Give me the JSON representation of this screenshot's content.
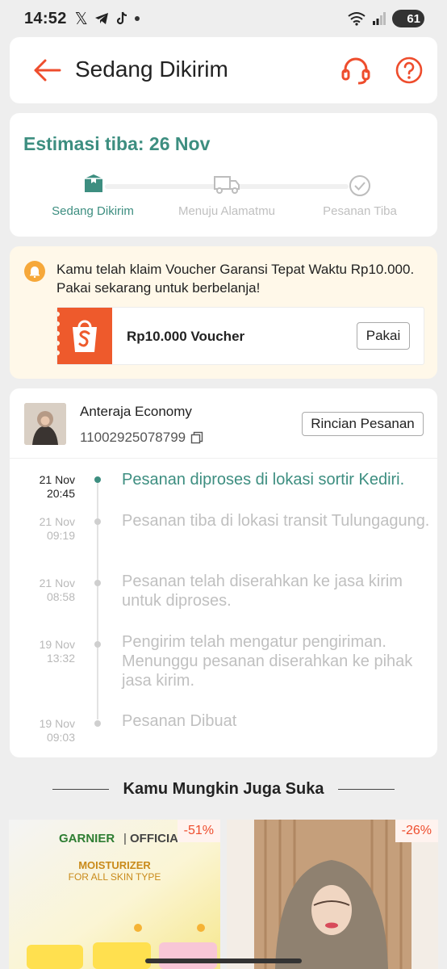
{
  "status_bar": {
    "time": "14:52",
    "battery": "61",
    "apps": [
      "x-icon",
      "telegram-icon",
      "tiktok-icon"
    ]
  },
  "header": {
    "title": "Sedang Dikirim"
  },
  "estimate": {
    "title": "Estimasi tiba: 26 Nov",
    "steps": [
      {
        "label": "Sedang Dikirim",
        "icon": "package-icon",
        "active": true
      },
      {
        "label": "Menuju Alamatmu",
        "icon": "truck-icon",
        "active": false
      },
      {
        "label": "Pesanan Tiba",
        "icon": "check-circle-icon",
        "active": false
      }
    ]
  },
  "voucher": {
    "message": "Kamu telah klaim Voucher Garansi Tepat Waktu Rp10.000. Pakai sekarang untuk berbelanja!",
    "label": "Rp10.000 Voucher",
    "button": "Pakai"
  },
  "shipment": {
    "courier": "Anteraja Economy",
    "tracking_number": "11002925078799",
    "details_button": "Rincian Pesanan",
    "events": [
      {
        "date": "21 Nov",
        "time": "20:45",
        "text": "Pesanan diproses di lokasi sortir  Kediri.",
        "active": true
      },
      {
        "date": "21 Nov",
        "time": "09:19",
        "text": "Pesanan tiba di lokasi transit Tulungagung.",
        "active": false
      },
      {
        "date": "21 Nov",
        "time": "08:58",
        "text": "Pesanan telah diserahkan ke jasa kirim untuk diproses.",
        "active": false
      },
      {
        "date": "19 Nov",
        "time": "13:32",
        "text": "Pengirim telah mengatur pengiriman. Menunggu pesanan diserahkan ke pihak jasa kirim.",
        "active": false
      },
      {
        "date": "19 Nov",
        "time": "09:03",
        "text": "Pesanan Dibuat",
        "active": false
      }
    ]
  },
  "recommendations": {
    "title": "Kamu Mungkin Juga Suka",
    "products": [
      {
        "discount": "-51%",
        "brand": "GARNIER",
        "brand_tag": "OFFICIAL",
        "headline": "MOISTURIZER",
        "subline": "FOR ALL SKIN TYPE"
      },
      {
        "discount": "-26%"
      }
    ]
  },
  "colors": {
    "brand": "#ee4d2d",
    "teal": "#3d8e80",
    "voucher_bg": "#fff8e9"
  }
}
